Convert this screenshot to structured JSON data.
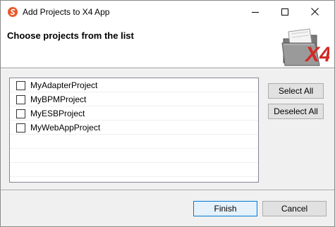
{
  "window": {
    "title": "Add Projects to X4 App",
    "app_icon": "x4-app-icon",
    "controls": {
      "minimize_icon": "minimize-icon",
      "maximize_icon": "maximize-icon",
      "close_icon": "close-icon"
    }
  },
  "header": {
    "heading": "Choose projects from the list",
    "logo_icon": "x4-folder-logo",
    "logo_text": "X4"
  },
  "project_list": {
    "items": [
      {
        "label": "MyAdapterProject",
        "checked": false
      },
      {
        "label": "MyBPMProject",
        "checked": false
      },
      {
        "label": "MyESBProject",
        "checked": false
      },
      {
        "label": "MyWebAppProject",
        "checked": false
      }
    ]
  },
  "side_buttons": {
    "select_all": "Select All",
    "deselect_all": "Deselect All"
  },
  "footer": {
    "finish": "Finish",
    "cancel": "Cancel"
  },
  "colors": {
    "app_icon_accent": "#e8582a",
    "logo_red": "#d12a24",
    "default_button_border": "#0078d7"
  }
}
